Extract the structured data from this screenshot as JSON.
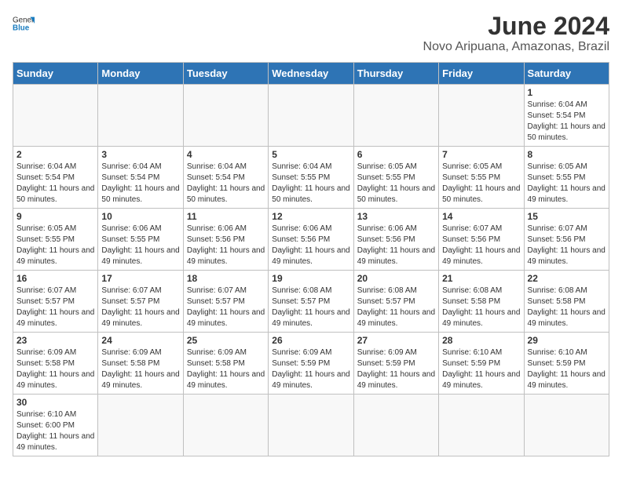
{
  "header": {
    "logo_general": "General",
    "logo_blue": "Blue",
    "title": "June 2024",
    "subtitle": "Novo Aripuana, Amazonas, Brazil"
  },
  "calendar": {
    "days_of_week": [
      "Sunday",
      "Monday",
      "Tuesday",
      "Wednesday",
      "Thursday",
      "Friday",
      "Saturday"
    ],
    "weeks": [
      [
        {
          "day": "",
          "info": ""
        },
        {
          "day": "",
          "info": ""
        },
        {
          "day": "",
          "info": ""
        },
        {
          "day": "",
          "info": ""
        },
        {
          "day": "",
          "info": ""
        },
        {
          "day": "",
          "info": ""
        },
        {
          "day": "1",
          "info": "Sunrise: 6:04 AM\nSunset: 5:54 PM\nDaylight: 11 hours and 50 minutes."
        }
      ],
      [
        {
          "day": "2",
          "info": "Sunrise: 6:04 AM\nSunset: 5:54 PM\nDaylight: 11 hours and 50 minutes."
        },
        {
          "day": "3",
          "info": "Sunrise: 6:04 AM\nSunset: 5:54 PM\nDaylight: 11 hours and 50 minutes."
        },
        {
          "day": "4",
          "info": "Sunrise: 6:04 AM\nSunset: 5:54 PM\nDaylight: 11 hours and 50 minutes."
        },
        {
          "day": "5",
          "info": "Sunrise: 6:04 AM\nSunset: 5:55 PM\nDaylight: 11 hours and 50 minutes."
        },
        {
          "day": "6",
          "info": "Sunrise: 6:05 AM\nSunset: 5:55 PM\nDaylight: 11 hours and 50 minutes."
        },
        {
          "day": "7",
          "info": "Sunrise: 6:05 AM\nSunset: 5:55 PM\nDaylight: 11 hours and 50 minutes."
        },
        {
          "day": "8",
          "info": "Sunrise: 6:05 AM\nSunset: 5:55 PM\nDaylight: 11 hours and 49 minutes."
        }
      ],
      [
        {
          "day": "9",
          "info": "Sunrise: 6:05 AM\nSunset: 5:55 PM\nDaylight: 11 hours and 49 minutes."
        },
        {
          "day": "10",
          "info": "Sunrise: 6:06 AM\nSunset: 5:55 PM\nDaylight: 11 hours and 49 minutes."
        },
        {
          "day": "11",
          "info": "Sunrise: 6:06 AM\nSunset: 5:56 PM\nDaylight: 11 hours and 49 minutes."
        },
        {
          "day": "12",
          "info": "Sunrise: 6:06 AM\nSunset: 5:56 PM\nDaylight: 11 hours and 49 minutes."
        },
        {
          "day": "13",
          "info": "Sunrise: 6:06 AM\nSunset: 5:56 PM\nDaylight: 11 hours and 49 minutes."
        },
        {
          "day": "14",
          "info": "Sunrise: 6:07 AM\nSunset: 5:56 PM\nDaylight: 11 hours and 49 minutes."
        },
        {
          "day": "15",
          "info": "Sunrise: 6:07 AM\nSunset: 5:56 PM\nDaylight: 11 hours and 49 minutes."
        }
      ],
      [
        {
          "day": "16",
          "info": "Sunrise: 6:07 AM\nSunset: 5:57 PM\nDaylight: 11 hours and 49 minutes."
        },
        {
          "day": "17",
          "info": "Sunrise: 6:07 AM\nSunset: 5:57 PM\nDaylight: 11 hours and 49 minutes."
        },
        {
          "day": "18",
          "info": "Sunrise: 6:07 AM\nSunset: 5:57 PM\nDaylight: 11 hours and 49 minutes."
        },
        {
          "day": "19",
          "info": "Sunrise: 6:08 AM\nSunset: 5:57 PM\nDaylight: 11 hours and 49 minutes."
        },
        {
          "day": "20",
          "info": "Sunrise: 6:08 AM\nSunset: 5:57 PM\nDaylight: 11 hours and 49 minutes."
        },
        {
          "day": "21",
          "info": "Sunrise: 6:08 AM\nSunset: 5:58 PM\nDaylight: 11 hours and 49 minutes."
        },
        {
          "day": "22",
          "info": "Sunrise: 6:08 AM\nSunset: 5:58 PM\nDaylight: 11 hours and 49 minutes."
        }
      ],
      [
        {
          "day": "23",
          "info": "Sunrise: 6:09 AM\nSunset: 5:58 PM\nDaylight: 11 hours and 49 minutes."
        },
        {
          "day": "24",
          "info": "Sunrise: 6:09 AM\nSunset: 5:58 PM\nDaylight: 11 hours and 49 minutes."
        },
        {
          "day": "25",
          "info": "Sunrise: 6:09 AM\nSunset: 5:58 PM\nDaylight: 11 hours and 49 minutes."
        },
        {
          "day": "26",
          "info": "Sunrise: 6:09 AM\nSunset: 5:59 PM\nDaylight: 11 hours and 49 minutes."
        },
        {
          "day": "27",
          "info": "Sunrise: 6:09 AM\nSunset: 5:59 PM\nDaylight: 11 hours and 49 minutes."
        },
        {
          "day": "28",
          "info": "Sunrise: 6:10 AM\nSunset: 5:59 PM\nDaylight: 11 hours and 49 minutes."
        },
        {
          "day": "29",
          "info": "Sunrise: 6:10 AM\nSunset: 5:59 PM\nDaylight: 11 hours and 49 minutes."
        }
      ],
      [
        {
          "day": "30",
          "info": "Sunrise: 6:10 AM\nSunset: 6:00 PM\nDaylight: 11 hours and 49 minutes."
        },
        {
          "day": "",
          "info": ""
        },
        {
          "day": "",
          "info": ""
        },
        {
          "day": "",
          "info": ""
        },
        {
          "day": "",
          "info": ""
        },
        {
          "day": "",
          "info": ""
        },
        {
          "day": "",
          "info": ""
        }
      ]
    ]
  }
}
